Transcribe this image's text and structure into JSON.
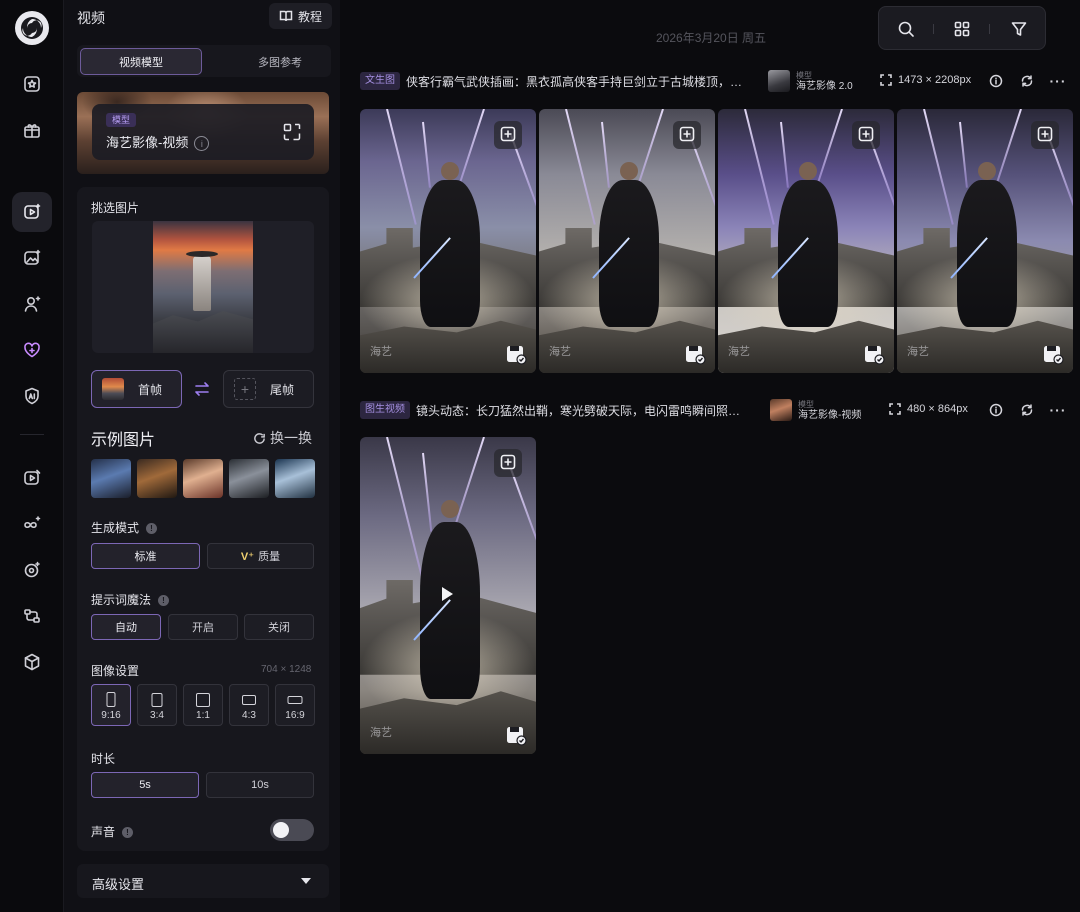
{
  "rail": {
    "items": [
      {
        "name": "rail-explore",
        "icon": "star-box-icon"
      },
      {
        "name": "rail-gift",
        "icon": "gift-icon"
      },
      {
        "name": "rail-video",
        "icon": "video-spark-icon"
      },
      {
        "name": "rail-image",
        "icon": "image-spark-icon"
      },
      {
        "name": "rail-character",
        "icon": "person-spark-icon"
      },
      {
        "name": "rail-favorites",
        "icon": "heart-plus-icon"
      },
      {
        "name": "rail-ai",
        "icon": "ai-shield-icon"
      },
      {
        "name": "rail-video-edit",
        "icon": "video-edit-icon"
      },
      {
        "name": "rail-infinite",
        "icon": "infinity-spark-icon"
      },
      {
        "name": "rail-target",
        "icon": "target-spark-icon"
      },
      {
        "name": "rail-workflow",
        "icon": "workflow-icon"
      },
      {
        "name": "rail-3d",
        "icon": "cube-icon"
      }
    ]
  },
  "panel": {
    "title": "视频",
    "tutorial_label": "教程",
    "tabs": [
      "视频模型",
      "多图参考"
    ],
    "model": {
      "tag": "模型",
      "name": "海艺影像-视频"
    },
    "pick_label": "挑选图片",
    "first_frame": "首帧",
    "last_frame": "尾帧",
    "examples_title": "示例图片",
    "refresh_label": "换一换",
    "gen_mode": {
      "label": "生成模式",
      "options": [
        "标准",
        "质量"
      ],
      "selected": "标准"
    },
    "prompt_magic": {
      "label": "提示词魔法",
      "options": [
        "自动",
        "开启",
        "关闭"
      ],
      "selected": "自动"
    },
    "image_settings": {
      "label": "图像设置",
      "size": "704 × 1248",
      "ratios": [
        "9:16",
        "3:4",
        "1:1",
        "4:3",
        "16:9"
      ],
      "selected": "9:16"
    },
    "duration": {
      "label": "时长",
      "options": [
        "5s",
        "10s"
      ],
      "selected": "5s"
    },
    "sound": {
      "label": "声音",
      "enabled": false
    },
    "advanced_label": "高级设置"
  },
  "main": {
    "date": "2026年3月20日 周五",
    "toolbar": [
      "search-icon",
      "grid-icon",
      "filter-icon"
    ],
    "generations": [
      {
        "type": "文生图",
        "prompt": "侠客行霸气武侠插画：黑衣孤高侠客手持巨剑立于古城楼顶，…",
        "model_sub": "模型",
        "model_name": "海艺影像 2.0",
        "size": "1473 × 2208px",
        "image_count": 4
      },
      {
        "type": "图生视频",
        "prompt": "镜头动态：长刀猛然出鞘，寒光劈破天际，电闪雷鸣瞬间照…",
        "model_sub": "模型",
        "model_name": "海艺影像-视频",
        "size": "480 × 864px",
        "image_count": 1
      }
    ],
    "watermark": "海艺"
  },
  "colors": {
    "accent": "#7c67b5",
    "accent_text": "#a48fe0",
    "bg": "#0b0b0e",
    "panel": "#17171d"
  }
}
